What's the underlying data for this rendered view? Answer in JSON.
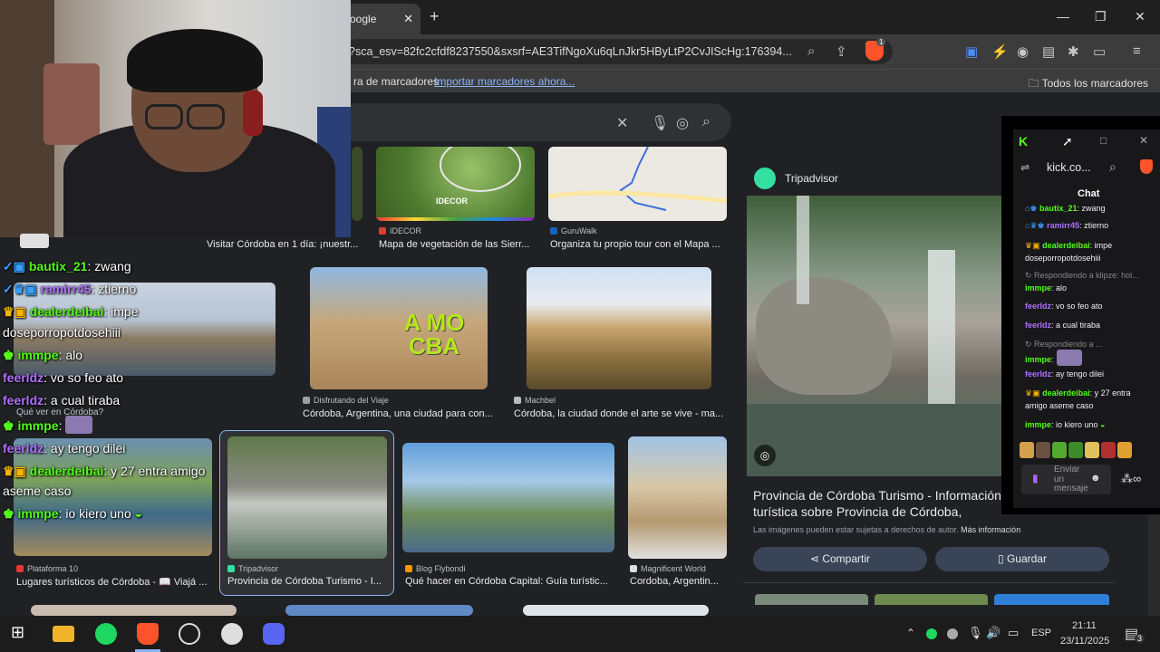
{
  "browser": {
    "tab_title": "oogle",
    "tab_close": "✕",
    "new_tab": "+",
    "url": "?sca_esv=82fc2cfdf8237550&sxsrf=AE3TifNgoXu6qLnJkr5HByLtP2CvJIScHg:176394...",
    "bookmarks_bar_text": "ra de marcadores",
    "import_link": "Importar marcadores ahora...",
    "all_bookmarks": "Todos los marcadores",
    "brave_badge": "1"
  },
  "search": {
    "clear": "✕"
  },
  "top_row": [
    {
      "caption": "Visitar Córdoba en 1 día: ¡nuestr...",
      "source": ""
    },
    {
      "caption": "Mapa de vegetación de las Sierr...",
      "source": "IDECOR",
      "logo_text": "IDECOR"
    },
    {
      "caption": "Organiza tu propio tour con el Mapa ...",
      "source": "GuruWalk"
    }
  ],
  "middle_row": [
    {
      "caption": "Qué ver en Córdoba?",
      "source": ""
    },
    {
      "caption": "Córdoba, Argentina, una ciudad para con...",
      "source": "Disfrutando del Viaje",
      "sign_text": "A MO CBA"
    },
    {
      "caption": "Córdoba, la ciudad donde el arte se vive - ma...",
      "source": "Machbel"
    }
  ],
  "bottom_row": [
    {
      "caption": "Lugares turísticos de Córdoba - 📖 Viajá ...",
      "source": "Plataforma 10"
    },
    {
      "caption": "Provincia de Córdoba Turismo - I...",
      "source": "Tripadvisor"
    },
    {
      "caption": "Qué hacer en Córdoba Capital: Guía turístic...",
      "source": "Blog Flybondi"
    },
    {
      "caption": "Cordoba, Argentin...",
      "source": "Magnificent World"
    }
  ],
  "preview": {
    "source": "Tripadvisor",
    "title": "Provincia de Córdoba Turismo - Información turística sobre Provincia de Córdoba, Argentina",
    "rights": "Las imágenes pueden estar sujetas a derechos de autor.",
    "more_info": "Más información",
    "share": "Compartir",
    "save": "Guardar"
  },
  "chat_window": {
    "site": "kick.co...",
    "title": "Chat",
    "input_placeholder": "Enviar un mensaje",
    "messages": [
      {
        "user": "bautix_21",
        "text": ": zwang",
        "color": "#53fc18"
      },
      {
        "user": "ramirr45",
        "text": ": ztierno",
        "color": "#b070ff"
      },
      {
        "user": "dealerdeibai",
        "text": ": impe doseporropotdosehiii",
        "color": "#53fc18"
      },
      {
        "reply": "Respondiendo a klipze: hol..."
      },
      {
        "user": "immpe",
        "text": ": alo",
        "color": "#53fc18"
      },
      {
        "user": "feerldz",
        "text": ": vo so feo ato",
        "color": "#b070ff"
      },
      {
        "user": "feerldz",
        "text": ": a cual tiraba",
        "color": "#b070ff"
      },
      {
        "reply": "Respondiendo a ..."
      },
      {
        "user": "immpe",
        "text": ":",
        "color": "#53fc18"
      },
      {
        "user": "feerldz",
        "text": ": ay tengo dilei",
        "color": "#b070ff"
      },
      {
        "user": "dealerdeibai",
        "text": ": y 27 entra amigo aseme caso",
        "color": "#53fc18"
      },
      {
        "user": "immpe",
        "text": ": io kiero uno",
        "color": "#53fc18"
      }
    ]
  },
  "overlay_chat": [
    {
      "user": "bautix_21",
      "text": ": zwang",
      "color": "#53fc18"
    },
    {
      "user": "ramirr45",
      "text": ": ztierno",
      "color": "#b070ff"
    },
    {
      "user": "dealerdeibai",
      "text": ": impe",
      "color": "#53fc18"
    },
    {
      "user": "",
      "text": "doseporropotdosehiii",
      "color": "#ffffff"
    },
    {
      "user": "immpe",
      "text": ": alo",
      "color": "#53fc18"
    },
    {
      "user": "feerldz",
      "text": ": vo so feo ato",
      "color": "#b070ff"
    },
    {
      "user": "feerldz",
      "text": ": a cual tiraba",
      "color": "#b070ff"
    },
    {
      "user": "immpe",
      "text": ":",
      "color": "#53fc18"
    },
    {
      "user": "feerldz",
      "text": ": ay tengo dilei",
      "color": "#b070ff"
    },
    {
      "user": "dealerdeibai",
      "text": ": y 27 entra amigo",
      "color": "#53fc18"
    },
    {
      "user": "",
      "text": "aseme caso",
      "color": "#ffffff"
    },
    {
      "user": "immpe",
      "text": ": io kiero uno",
      "color": "#53fc18"
    }
  ],
  "taskbar": {
    "lang": "ESP",
    "time": "21:11",
    "date": "23/11/2025",
    "notif_count": "3"
  }
}
